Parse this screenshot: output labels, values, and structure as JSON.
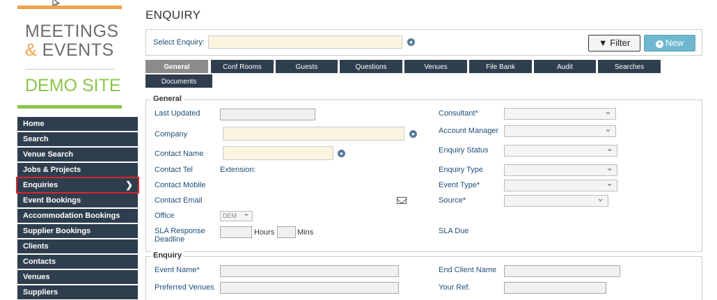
{
  "logo": {
    "line1": "MEETINGS",
    "line2_amp": "&",
    "line2_rest": " EVENTS",
    "demo": "DEMO SITE"
  },
  "nav": {
    "items": [
      {
        "label": "Home"
      },
      {
        "label": "Search"
      },
      {
        "label": "Venue Search"
      },
      {
        "label": "Jobs & Projects"
      },
      {
        "label": "Enquiries",
        "active": true
      },
      {
        "label": "Event Bookings"
      },
      {
        "label": "Accommodation Bookings"
      },
      {
        "label": "Supplier Bookings"
      },
      {
        "label": "Clients"
      },
      {
        "label": "Contacts"
      },
      {
        "label": "Venues"
      },
      {
        "label": "Suppliers"
      }
    ]
  },
  "page": {
    "title": "ENQUIRY"
  },
  "enquiry_bar": {
    "select_label": "Select Enquiry:",
    "select_value": "",
    "filter_label": "Filter",
    "new_label": "New"
  },
  "tabs": [
    {
      "label": "General",
      "active": true
    },
    {
      "label": "Conf Rooms"
    },
    {
      "label": "Guests"
    },
    {
      "label": "Questions"
    },
    {
      "label": "Venues"
    },
    {
      "label": "File Bank"
    },
    {
      "label": "Audit"
    },
    {
      "label": "Searches"
    },
    {
      "label": "Documents"
    }
  ],
  "general": {
    "legend": "General",
    "last_updated": "Last Updated",
    "company": "Company",
    "contact_name": "Contact Name",
    "contact_tel": "Contact Tel",
    "extension": "Extension:",
    "contact_mobile": "Contact Mobile",
    "contact_email": "Contact Email",
    "office": "Office",
    "office_value": "DEM",
    "sla_response": "SLA Response",
    "deadline": "Deadline",
    "hours": "Hours",
    "mins": "Mins",
    "consultant": "Consultant*",
    "account_manager": "Account Manager",
    "enquiry_status": "Enquiry Status",
    "enquiry_type": "Enquiry Type",
    "event_type": "Event Type*",
    "source": "Source*",
    "sla_due": "SLA Due"
  },
  "enquiry": {
    "legend": "Enquiry",
    "event_name": "Event Name*",
    "preferred_venues": "Preferred Venues",
    "end_client_name": "End Client Name",
    "your_ref": "Your Ref."
  }
}
